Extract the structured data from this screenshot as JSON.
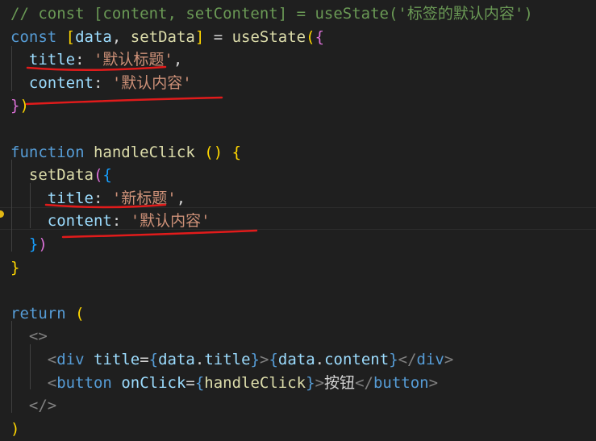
{
  "theme": {
    "background": "#1f1f1f",
    "comment": "#6a9955",
    "keyword": "#569cd6",
    "function": "#dcdcaa",
    "property": "#9cdcfe",
    "string": "#ce9178",
    "brace_gold": "#ffd700",
    "brace_purple": "#da70d6",
    "brace_blue": "#179fff",
    "tag": "#569cd6",
    "tag_bracket": "#808080",
    "text": "#d4d4d4",
    "annotation": "#e11b1b"
  },
  "code_lines": [
    {
      "tokens": [
        {
          "t": "// const [content, setContent] = useState('标签的默认内容')",
          "c": "comment"
        }
      ]
    },
    {
      "tokens": [
        {
          "t": "const ",
          "c": "keyword"
        },
        {
          "t": "[",
          "c": "brace_gold"
        },
        {
          "t": "data",
          "c": "property"
        },
        {
          "t": ", ",
          "c": "text"
        },
        {
          "t": "setData",
          "c": "function"
        },
        {
          "t": "]",
          "c": "brace_gold"
        },
        {
          "t": " = ",
          "c": "text"
        },
        {
          "t": "useState",
          "c": "function"
        },
        {
          "t": "(",
          "c": "brace_gold"
        },
        {
          "t": "{",
          "c": "brace_purple"
        }
      ]
    },
    {
      "tokens": [
        {
          "t": "  ",
          "c": "text"
        },
        {
          "t": "title",
          "c": "property"
        },
        {
          "t": ": ",
          "c": "text"
        },
        {
          "t": "'默认标题'",
          "c": "string"
        },
        {
          "t": ",",
          "c": "text"
        }
      ]
    },
    {
      "tokens": [
        {
          "t": "  ",
          "c": "text"
        },
        {
          "t": "content",
          "c": "property"
        },
        {
          "t": ": ",
          "c": "text"
        },
        {
          "t": "'默认内容'",
          "c": "string"
        }
      ]
    },
    {
      "tokens": [
        {
          "t": "}",
          "c": "brace_purple"
        },
        {
          "t": ")",
          "c": "brace_gold"
        }
      ]
    },
    {
      "tokens": []
    },
    {
      "tokens": [
        {
          "t": "function ",
          "c": "keyword"
        },
        {
          "t": "handleClick",
          "c": "function"
        },
        {
          "t": " ",
          "c": "text"
        },
        {
          "t": "()",
          "c": "brace_gold"
        },
        {
          "t": " ",
          "c": "text"
        },
        {
          "t": "{",
          "c": "brace_gold"
        }
      ]
    },
    {
      "tokens": [
        {
          "t": "  ",
          "c": "text"
        },
        {
          "t": "setData",
          "c": "function"
        },
        {
          "t": "(",
          "c": "brace_purple"
        },
        {
          "t": "{",
          "c": "brace_blue"
        }
      ]
    },
    {
      "tokens": [
        {
          "t": "    ",
          "c": "text"
        },
        {
          "t": "title",
          "c": "property"
        },
        {
          "t": ": ",
          "c": "text"
        },
        {
          "t": "'新标题'",
          "c": "string"
        },
        {
          "t": ",",
          "c": "text"
        }
      ]
    },
    {
      "tokens": [
        {
          "t": "    ",
          "c": "text"
        },
        {
          "t": "content",
          "c": "property"
        },
        {
          "t": ": ",
          "c": "text"
        },
        {
          "t": "'默认内容'",
          "c": "string"
        }
      ]
    },
    {
      "tokens": [
        {
          "t": "  ",
          "c": "text"
        },
        {
          "t": "}",
          "c": "brace_blue"
        },
        {
          "t": ")",
          "c": "brace_purple"
        }
      ]
    },
    {
      "tokens": [
        {
          "t": "}",
          "c": "brace_gold"
        }
      ]
    },
    {
      "tokens": []
    },
    {
      "tokens": [
        {
          "t": "return ",
          "c": "keyword"
        },
        {
          "t": "(",
          "c": "brace_gold"
        }
      ]
    },
    {
      "tokens": [
        {
          "t": "  ",
          "c": "text"
        },
        {
          "t": "<>",
          "c": "tag_bracket"
        }
      ]
    },
    {
      "tokens": [
        {
          "t": "    ",
          "c": "text"
        },
        {
          "t": "<",
          "c": "tag_bracket"
        },
        {
          "t": "div",
          "c": "tag"
        },
        {
          "t": " ",
          "c": "text"
        },
        {
          "t": "title",
          "c": "property"
        },
        {
          "t": "=",
          "c": "text"
        },
        {
          "t": "{",
          "c": "keyword"
        },
        {
          "t": "data",
          "c": "property"
        },
        {
          "t": ".",
          "c": "text"
        },
        {
          "t": "title",
          "c": "property"
        },
        {
          "t": "}",
          "c": "keyword"
        },
        {
          "t": ">",
          "c": "tag_bracket"
        },
        {
          "t": "{",
          "c": "keyword"
        },
        {
          "t": "data",
          "c": "property"
        },
        {
          "t": ".",
          "c": "text"
        },
        {
          "t": "content",
          "c": "property"
        },
        {
          "t": "}",
          "c": "keyword"
        },
        {
          "t": "</",
          "c": "tag_bracket"
        },
        {
          "t": "div",
          "c": "tag"
        },
        {
          "t": ">",
          "c": "tag_bracket"
        }
      ]
    },
    {
      "tokens": [
        {
          "t": "    ",
          "c": "text"
        },
        {
          "t": "<",
          "c": "tag_bracket"
        },
        {
          "t": "button",
          "c": "tag"
        },
        {
          "t": " ",
          "c": "text"
        },
        {
          "t": "onClick",
          "c": "property"
        },
        {
          "t": "=",
          "c": "text"
        },
        {
          "t": "{",
          "c": "keyword"
        },
        {
          "t": "handleClick",
          "c": "function"
        },
        {
          "t": "}",
          "c": "keyword"
        },
        {
          "t": ">",
          "c": "tag_bracket"
        },
        {
          "t": "按钮",
          "c": "text"
        },
        {
          "t": "</",
          "c": "tag_bracket"
        },
        {
          "t": "button",
          "c": "tag"
        },
        {
          "t": ">",
          "c": "tag_bracket"
        }
      ]
    },
    {
      "tokens": [
        {
          "t": "  ",
          "c": "text"
        },
        {
          "t": "</>",
          "c": "tag_bracket"
        }
      ]
    },
    {
      "tokens": [
        {
          "t": ")",
          "c": "brace_gold"
        }
      ]
    }
  ]
}
